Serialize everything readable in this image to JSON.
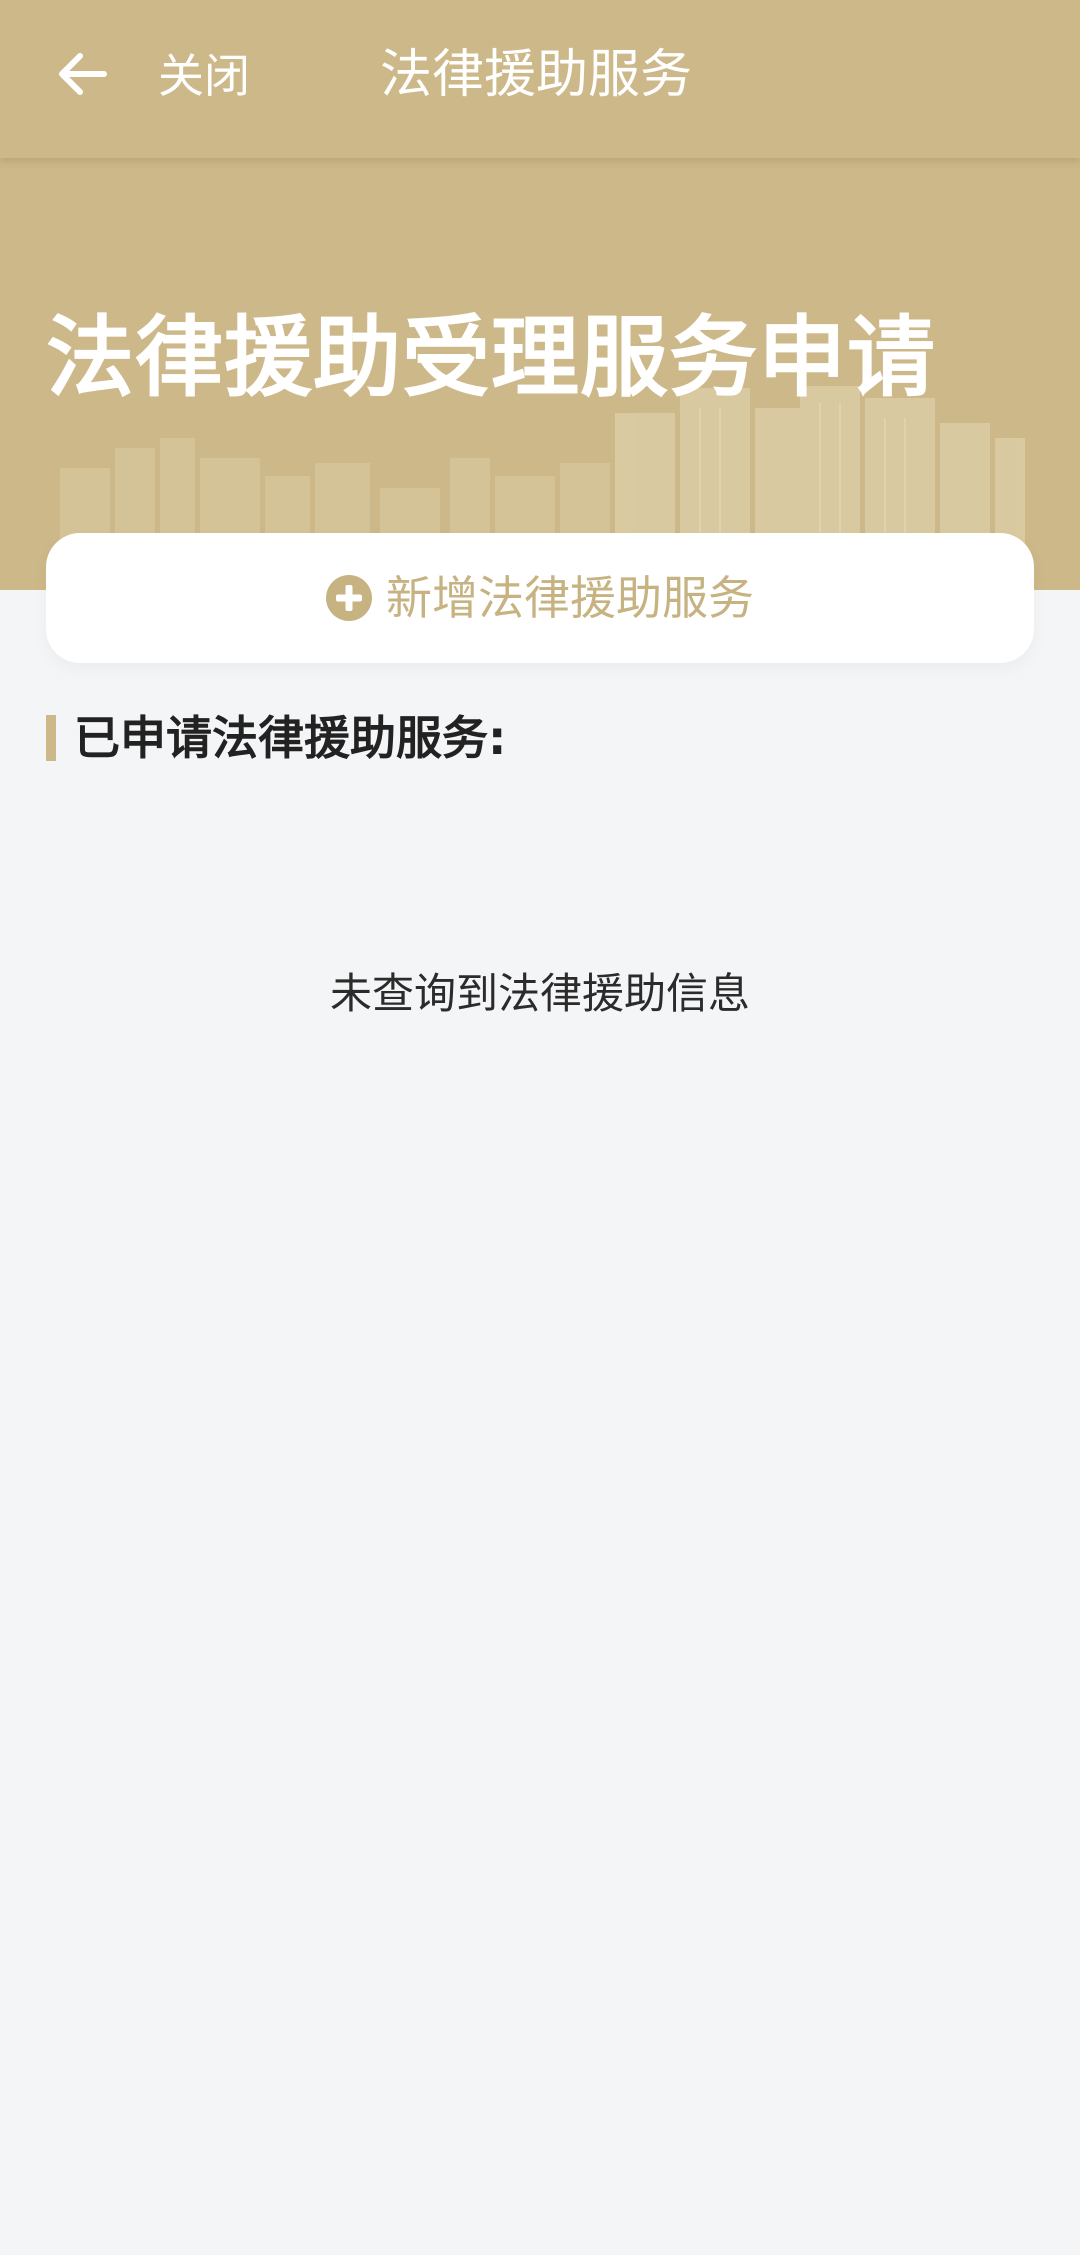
{
  "nav": {
    "back_icon": "arrow-left-icon",
    "close_label": "关闭",
    "title": "法律援助服务"
  },
  "hero": {
    "title": "法律援助受理服务申请"
  },
  "add_card": {
    "icon": "plus-circle-icon",
    "label": "新增法律援助服务"
  },
  "section": {
    "title": "已申请法律援助服务:"
  },
  "empty_state": {
    "message": "未查询到法律援助信息"
  },
  "colors": {
    "brand_gold": "#cdb889",
    "accent_text": "#c7b281",
    "page_bg": "#f4f5f7"
  }
}
